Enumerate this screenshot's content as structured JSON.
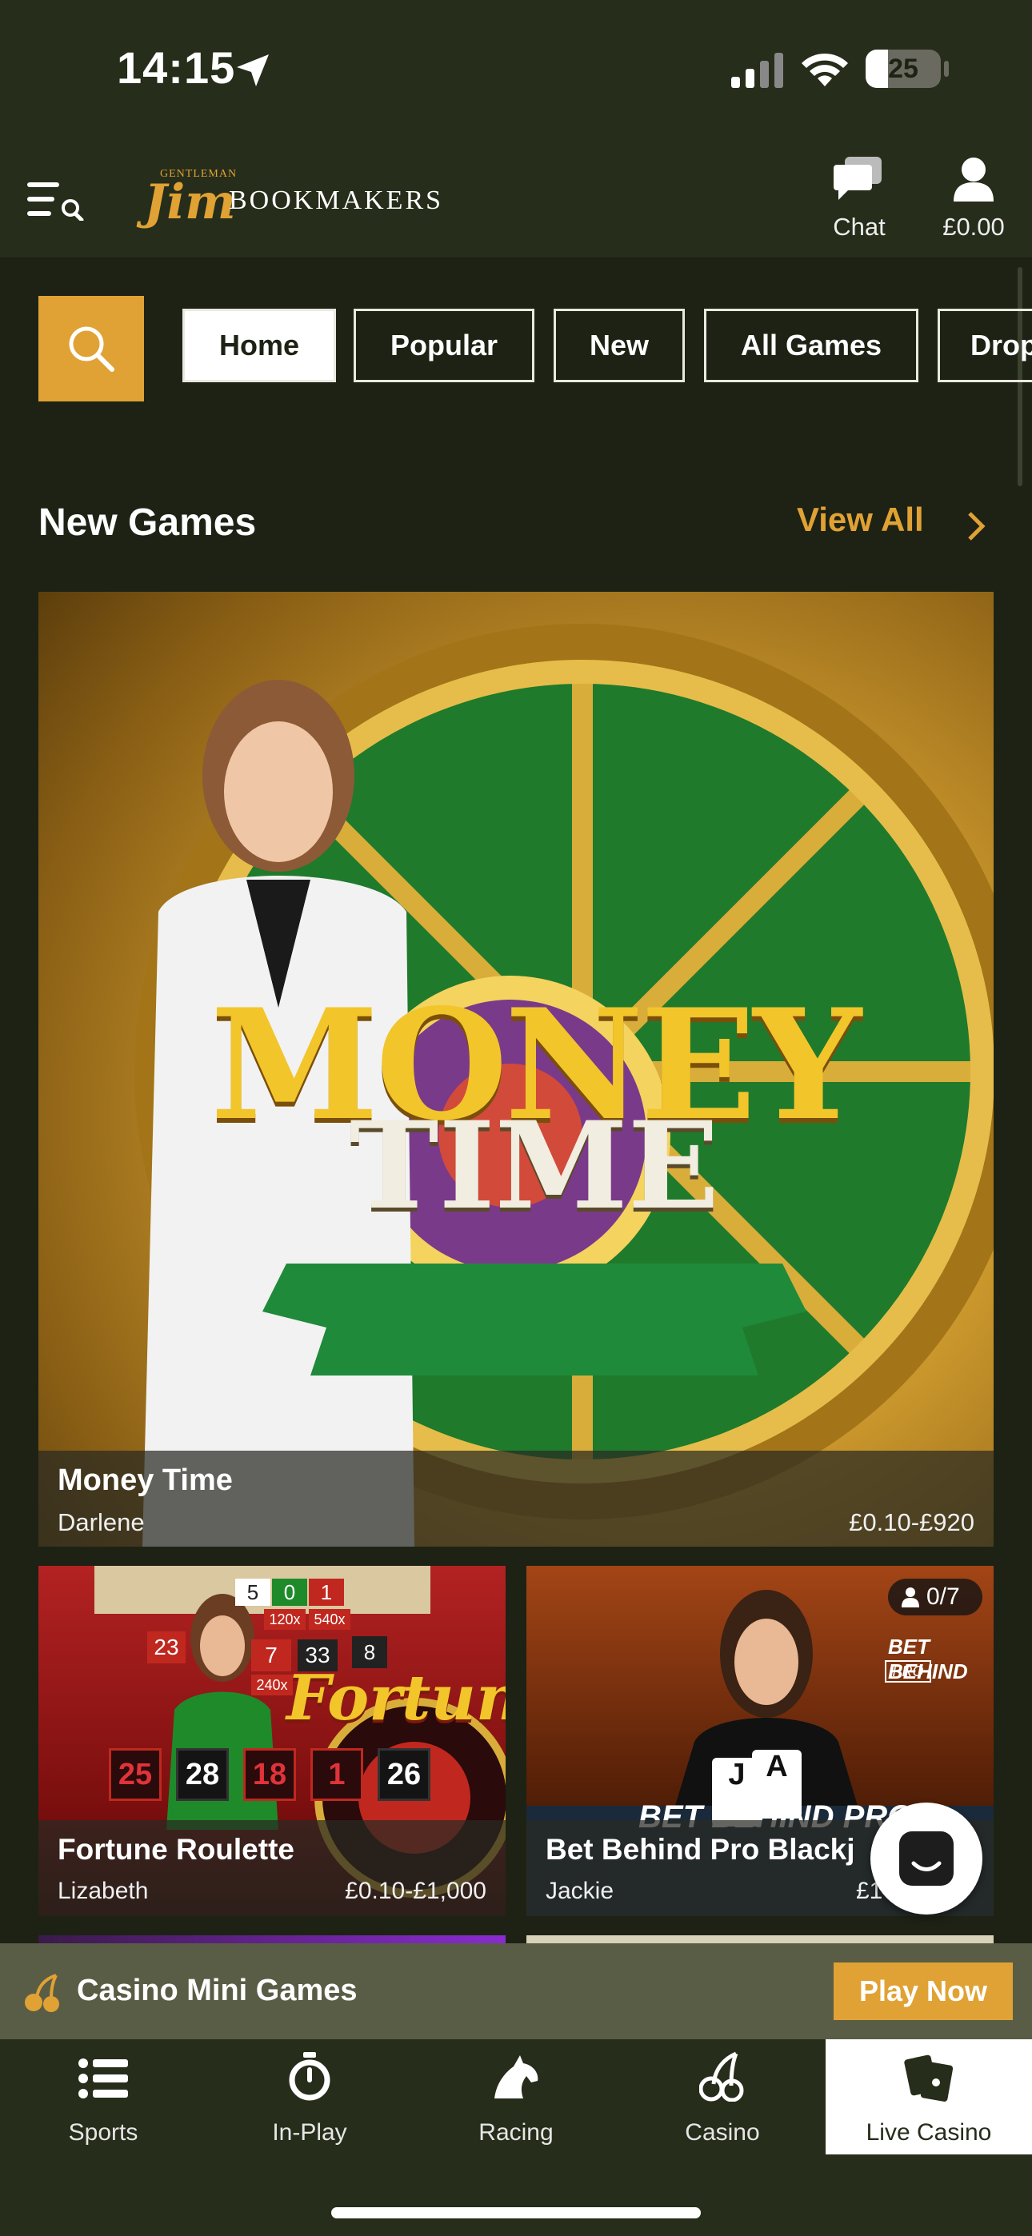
{
  "status_bar": {
    "time": "14:15",
    "battery": "25"
  },
  "header": {
    "logo_top": "GENTLEMAN",
    "logo_script": "Jim",
    "logo_text": "BOOKMAKERS",
    "chat_label": "Chat",
    "balance": "£0.00"
  },
  "filters": [
    {
      "label": "Home",
      "active": true
    },
    {
      "label": "Popular",
      "active": false
    },
    {
      "label": "New",
      "active": false
    },
    {
      "label": "All Games",
      "active": false
    },
    {
      "label": "Drop",
      "active": false
    }
  ],
  "section": {
    "title": "New Games",
    "view_all": "View All"
  },
  "featured": {
    "logo_line1": "MONEY",
    "logo_line2": "TIME",
    "title": "Money Time",
    "dealer": "Darlene",
    "stakes": "£0.10-£920"
  },
  "games": [
    {
      "title": "Fortune Roulette",
      "dealer": "Lizabeth",
      "stakes": "£0.10-£1,000",
      "brand": "Fortune",
      "results": [
        "25",
        "28",
        "18",
        "1",
        "26"
      ],
      "board": [
        "5",
        "0",
        "1",
        "120x",
        "540x",
        "23",
        "7",
        "33",
        "8",
        "240x"
      ]
    },
    {
      "title": "Bet Behind Pro Blackj",
      "dealer": "Jackie",
      "stakes": "£1",
      "seats": "0/7",
      "brand_line1": "BET BEHIND",
      "brand_line2": "PRO",
      "table_text": "BET BEHIND PRO",
      "cards": [
        "J",
        "A"
      ]
    }
  ],
  "promo": {
    "label": "Casino Mini Games",
    "button": "Play Now"
  },
  "bottom_nav": [
    {
      "label": "Sports",
      "icon": "list-icon",
      "active": false
    },
    {
      "label": "In-Play",
      "icon": "stopwatch-icon",
      "active": false
    },
    {
      "label": "Racing",
      "icon": "horse-icon",
      "active": false
    },
    {
      "label": "Casino",
      "icon": "cherries-icon",
      "active": false
    },
    {
      "label": "Live Casino",
      "icon": "playing-cards-icon",
      "active": true
    }
  ],
  "colors": {
    "background": "#1d2214",
    "header": "#262d1a",
    "accent": "#e0a234",
    "promo_bar": "#5a5d45"
  }
}
